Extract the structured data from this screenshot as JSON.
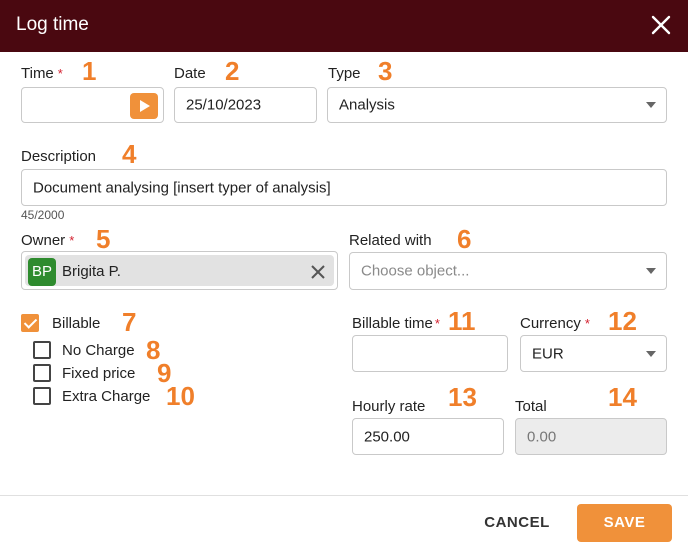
{
  "dialog": {
    "title": "Log time",
    "close_icon": "close-icon"
  },
  "fields": {
    "time": {
      "label": "Time",
      "required": "*",
      "value": "",
      "play_icon": "play-icon"
    },
    "date": {
      "label": "Date",
      "value": "25/10/2023"
    },
    "type": {
      "label": "Type",
      "value": "Analysis"
    },
    "description": {
      "label": "Description",
      "value": "Document analysing [insert typer of analysis]",
      "counter": "45/2000"
    },
    "owner": {
      "label": "Owner",
      "required": "*",
      "initials": "BP",
      "name": "Brigita P.",
      "avatar_color": "#2e8b2e"
    },
    "related": {
      "label": "Related with",
      "placeholder": "Choose object..."
    },
    "billable": {
      "label": "Billable",
      "checked": true
    },
    "no_charge": {
      "label": "No Charge",
      "checked": false
    },
    "fixed_price": {
      "label": "Fixed price",
      "checked": false
    },
    "extra_charge": {
      "label": "Extra Charge",
      "checked": false
    },
    "billable_time": {
      "label": "Billable time",
      "required": "*",
      "value": ""
    },
    "currency": {
      "label": "Currency",
      "required": "*",
      "value": "EUR"
    },
    "hourly_rate": {
      "label": "Hourly rate",
      "value": "250.00"
    },
    "total": {
      "label": "Total",
      "value": "0.00"
    }
  },
  "annotations": [
    "1",
    "2",
    "3",
    "4",
    "5",
    "6",
    "7",
    "8",
    "9",
    "10",
    "11",
    "12",
    "13",
    "14"
  ],
  "footer": {
    "cancel_label": "CANCEL",
    "save_label": "SAVE"
  },
  "colors": {
    "header": "#4a0810",
    "accent": "#f0913a",
    "annotation": "#f07f2a",
    "required": "#d4202f"
  }
}
